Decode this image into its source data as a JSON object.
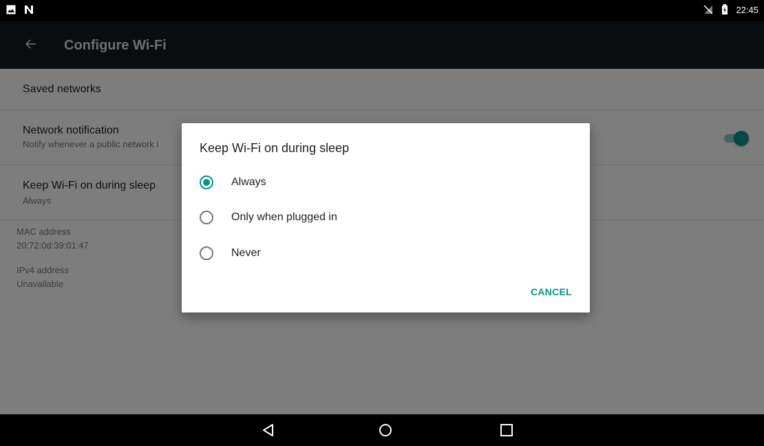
{
  "status_bar": {
    "time": "22:45",
    "left_icons": [
      "image-icon",
      "n-icon"
    ],
    "right_icons": [
      "no-sim-icon",
      "battery-charging-icon"
    ]
  },
  "app_bar": {
    "title": "Configure Wi-Fi"
  },
  "settings": {
    "saved_networks": "Saved networks",
    "network_notification": {
      "title": "Network notification",
      "subtitle": "Notify whenever a public network i",
      "toggle_on": true
    },
    "keep_wifi": {
      "title": "Keep Wi-Fi on during sleep",
      "subtitle": "Always"
    },
    "mac": {
      "label": "MAC address",
      "value": "20:72:0d:39:01:47"
    },
    "ipv4": {
      "label": "IPv4 address",
      "value": "Unavailable"
    }
  },
  "dialog": {
    "title": "Keep Wi-Fi on during sleep",
    "options": [
      {
        "label": "Always",
        "checked": true
      },
      {
        "label": "Only when plugged in",
        "checked": false
      },
      {
        "label": "Never",
        "checked": false
      }
    ],
    "cancel": "CANCEL"
  },
  "colors": {
    "accent": "#009688",
    "app_bar": "#121b21"
  }
}
